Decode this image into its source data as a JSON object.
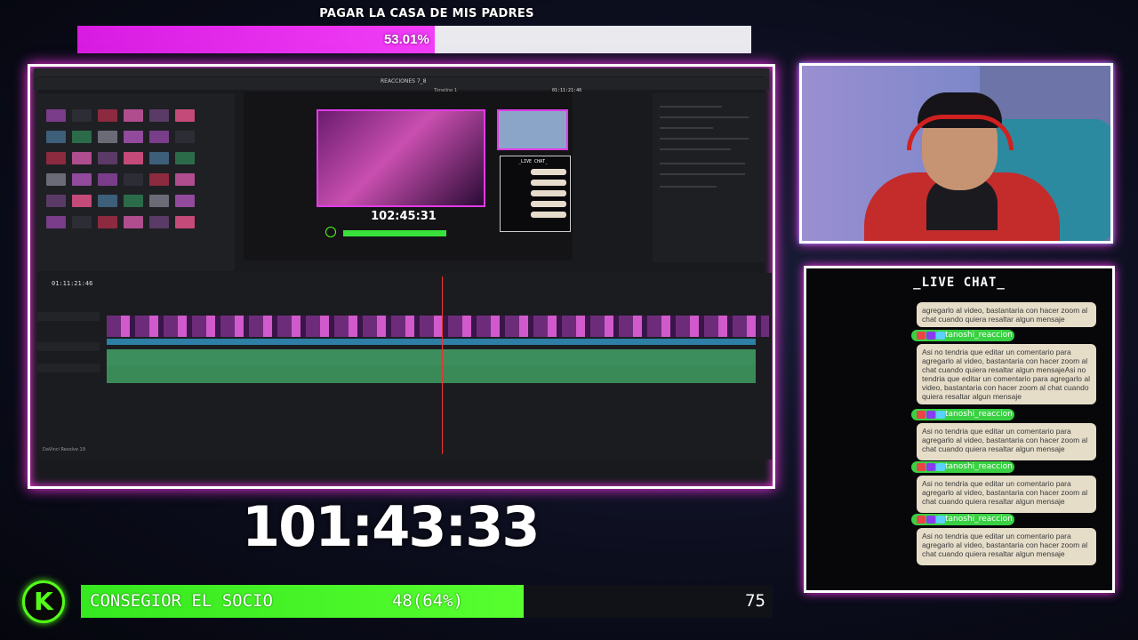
{
  "top_goal": {
    "title": "PAGAR LA CASA DE MIS PADRES",
    "progress_text": "53.01%",
    "progress": 0.5301,
    "fill_color": "#e01eea"
  },
  "editor": {
    "project_title": "REACCIONES 7_8",
    "timeline_name": "Timeline 1",
    "viewer_timecode": "01:11:21:46",
    "timeline_timecode": "01:11:21:46",
    "preview_timer": "102:45:31",
    "preview_chat_title": "_LIVE CHAT_",
    "app_name": "DaVinci Resolve 19"
  },
  "big_timer": "101:43:33",
  "bottom_goal": {
    "label": "CONSEGIOR EL SOCIO",
    "progress_text": "48(64%)",
    "target": "75",
    "progress": 0.64,
    "fill_color": "#4cf52a"
  },
  "chat": {
    "title": "_LIVE CHAT_",
    "messages": [
      {
        "user": "",
        "text": "agregarlo al video, bastantaria con hacer zoom al chat cuando quiera resaltar algun mensaje"
      },
      {
        "user": "tanoshi_reaccion",
        "text": "Asi no tendria que editar un comentario para agregarlo al video, bastantaria con hacer zoom al chat cuando quiera resaltar algun mensajeAsi no tendria que editar un comentario para agregarlo al video, bastantaria con hacer zoom al chat cuando quiera resaltar algun mensaje"
      },
      {
        "user": "tanoshi_reaccion",
        "text": "Asi no tendria que editar un comentario para agregarlo al video, bastantaria con hacer zoom al chat cuando quiera resaltar algun mensaje"
      },
      {
        "user": "tanoshi_reaccion",
        "text": "Asi no tendria que editar un comentario para agregarlo al video, bastantaria con hacer zoom al chat cuando quiera resaltar algun mensaje"
      },
      {
        "user": "tanoshi_reaccion",
        "text": "Asi no tendria que editar un comentario para agregarlo al video, bastantaria con hacer zoom al chat cuando quiera resaltar algun mensaje"
      }
    ]
  },
  "icons": {
    "brand_logo": "kick-k-icon",
    "chat_badges": [
      "broadcaster-badge-icon",
      "subscriber-badge-icon",
      "emote-badge-icon"
    ]
  },
  "colors": {
    "accent_pink": "#ff35f0",
    "accent_cyan": "#33e6ff",
    "accent_green": "#53fc18"
  }
}
